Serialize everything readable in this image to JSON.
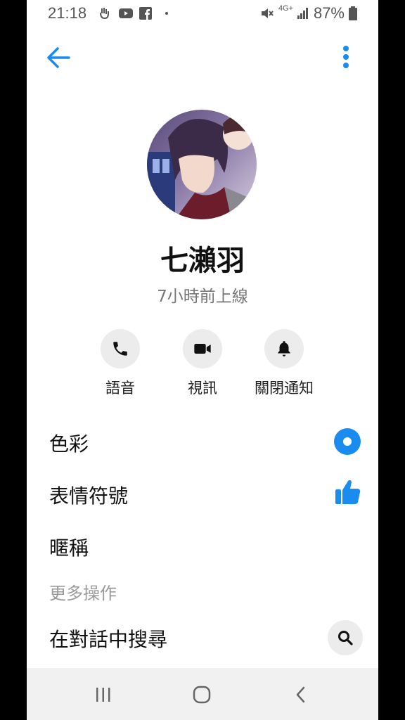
{
  "status_bar": {
    "time": "21:18",
    "network": "4G+",
    "battery": "87%",
    "icons": [
      "hand-icon",
      "youtube-icon",
      "facebook-icon",
      "dot-icon",
      "mute-icon",
      "signal-icon",
      "battery-icon"
    ]
  },
  "header": {
    "back_icon": "arrow-left-icon",
    "menu_icon": "more-vertical-icon",
    "accent": "#1a8cf0"
  },
  "profile": {
    "name": "七瀨羽",
    "presence": "7小時前上線"
  },
  "actions": [
    {
      "label": "語音",
      "icon": "phone-icon"
    },
    {
      "label": "視訊",
      "icon": "video-icon"
    },
    {
      "label": "關閉通知",
      "icon": "bell-icon"
    }
  ],
  "settings": {
    "color_label": "色彩",
    "emoji_label": "表情符號",
    "nickname_label": "暱稱",
    "more_actions_header": "更多操作",
    "search_label": "在對話中搜尋"
  },
  "navbar": {
    "icons": [
      "recent-apps-icon",
      "home-icon",
      "back-nav-icon"
    ]
  }
}
